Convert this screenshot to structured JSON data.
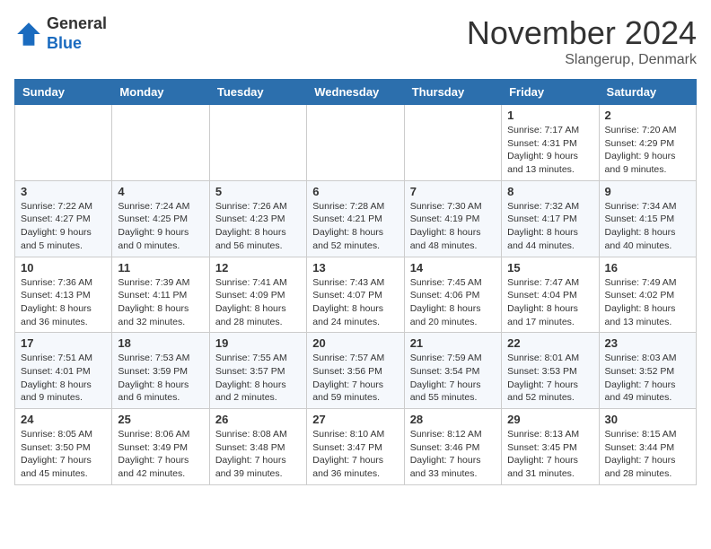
{
  "header": {
    "logo_general": "General",
    "logo_blue": "Blue",
    "month_title": "November 2024",
    "location": "Slangerup, Denmark"
  },
  "weekdays": [
    "Sunday",
    "Monday",
    "Tuesday",
    "Wednesday",
    "Thursday",
    "Friday",
    "Saturday"
  ],
  "weeks": [
    [
      {
        "day": "",
        "sunrise": "",
        "sunset": "",
        "daylight": ""
      },
      {
        "day": "",
        "sunrise": "",
        "sunset": "",
        "daylight": ""
      },
      {
        "day": "",
        "sunrise": "",
        "sunset": "",
        "daylight": ""
      },
      {
        "day": "",
        "sunrise": "",
        "sunset": "",
        "daylight": ""
      },
      {
        "day": "",
        "sunrise": "",
        "sunset": "",
        "daylight": ""
      },
      {
        "day": "1",
        "sunrise": "Sunrise: 7:17 AM",
        "sunset": "Sunset: 4:31 PM",
        "daylight": "Daylight: 9 hours and 13 minutes."
      },
      {
        "day": "2",
        "sunrise": "Sunrise: 7:20 AM",
        "sunset": "Sunset: 4:29 PM",
        "daylight": "Daylight: 9 hours and 9 minutes."
      }
    ],
    [
      {
        "day": "3",
        "sunrise": "Sunrise: 7:22 AM",
        "sunset": "Sunset: 4:27 PM",
        "daylight": "Daylight: 9 hours and 5 minutes."
      },
      {
        "day": "4",
        "sunrise": "Sunrise: 7:24 AM",
        "sunset": "Sunset: 4:25 PM",
        "daylight": "Daylight: 9 hours and 0 minutes."
      },
      {
        "day": "5",
        "sunrise": "Sunrise: 7:26 AM",
        "sunset": "Sunset: 4:23 PM",
        "daylight": "Daylight: 8 hours and 56 minutes."
      },
      {
        "day": "6",
        "sunrise": "Sunrise: 7:28 AM",
        "sunset": "Sunset: 4:21 PM",
        "daylight": "Daylight: 8 hours and 52 minutes."
      },
      {
        "day": "7",
        "sunrise": "Sunrise: 7:30 AM",
        "sunset": "Sunset: 4:19 PM",
        "daylight": "Daylight: 8 hours and 48 minutes."
      },
      {
        "day": "8",
        "sunrise": "Sunrise: 7:32 AM",
        "sunset": "Sunset: 4:17 PM",
        "daylight": "Daylight: 8 hours and 44 minutes."
      },
      {
        "day": "9",
        "sunrise": "Sunrise: 7:34 AM",
        "sunset": "Sunset: 4:15 PM",
        "daylight": "Daylight: 8 hours and 40 minutes."
      }
    ],
    [
      {
        "day": "10",
        "sunrise": "Sunrise: 7:36 AM",
        "sunset": "Sunset: 4:13 PM",
        "daylight": "Daylight: 8 hours and 36 minutes."
      },
      {
        "day": "11",
        "sunrise": "Sunrise: 7:39 AM",
        "sunset": "Sunset: 4:11 PM",
        "daylight": "Daylight: 8 hours and 32 minutes."
      },
      {
        "day": "12",
        "sunrise": "Sunrise: 7:41 AM",
        "sunset": "Sunset: 4:09 PM",
        "daylight": "Daylight: 8 hours and 28 minutes."
      },
      {
        "day": "13",
        "sunrise": "Sunrise: 7:43 AM",
        "sunset": "Sunset: 4:07 PM",
        "daylight": "Daylight: 8 hours and 24 minutes."
      },
      {
        "day": "14",
        "sunrise": "Sunrise: 7:45 AM",
        "sunset": "Sunset: 4:06 PM",
        "daylight": "Daylight: 8 hours and 20 minutes."
      },
      {
        "day": "15",
        "sunrise": "Sunrise: 7:47 AM",
        "sunset": "Sunset: 4:04 PM",
        "daylight": "Daylight: 8 hours and 17 minutes."
      },
      {
        "day": "16",
        "sunrise": "Sunrise: 7:49 AM",
        "sunset": "Sunset: 4:02 PM",
        "daylight": "Daylight: 8 hours and 13 minutes."
      }
    ],
    [
      {
        "day": "17",
        "sunrise": "Sunrise: 7:51 AM",
        "sunset": "Sunset: 4:01 PM",
        "daylight": "Daylight: 8 hours and 9 minutes."
      },
      {
        "day": "18",
        "sunrise": "Sunrise: 7:53 AM",
        "sunset": "Sunset: 3:59 PM",
        "daylight": "Daylight: 8 hours and 6 minutes."
      },
      {
        "day": "19",
        "sunrise": "Sunrise: 7:55 AM",
        "sunset": "Sunset: 3:57 PM",
        "daylight": "Daylight: 8 hours and 2 minutes."
      },
      {
        "day": "20",
        "sunrise": "Sunrise: 7:57 AM",
        "sunset": "Sunset: 3:56 PM",
        "daylight": "Daylight: 7 hours and 59 minutes."
      },
      {
        "day": "21",
        "sunrise": "Sunrise: 7:59 AM",
        "sunset": "Sunset: 3:54 PM",
        "daylight": "Daylight: 7 hours and 55 minutes."
      },
      {
        "day": "22",
        "sunrise": "Sunrise: 8:01 AM",
        "sunset": "Sunset: 3:53 PM",
        "daylight": "Daylight: 7 hours and 52 minutes."
      },
      {
        "day": "23",
        "sunrise": "Sunrise: 8:03 AM",
        "sunset": "Sunset: 3:52 PM",
        "daylight": "Daylight: 7 hours and 49 minutes."
      }
    ],
    [
      {
        "day": "24",
        "sunrise": "Sunrise: 8:05 AM",
        "sunset": "Sunset: 3:50 PM",
        "daylight": "Daylight: 7 hours and 45 minutes."
      },
      {
        "day": "25",
        "sunrise": "Sunrise: 8:06 AM",
        "sunset": "Sunset: 3:49 PM",
        "daylight": "Daylight: 7 hours and 42 minutes."
      },
      {
        "day": "26",
        "sunrise": "Sunrise: 8:08 AM",
        "sunset": "Sunset: 3:48 PM",
        "daylight": "Daylight: 7 hours and 39 minutes."
      },
      {
        "day": "27",
        "sunrise": "Sunrise: 8:10 AM",
        "sunset": "Sunset: 3:47 PM",
        "daylight": "Daylight: 7 hours and 36 minutes."
      },
      {
        "day": "28",
        "sunrise": "Sunrise: 8:12 AM",
        "sunset": "Sunset: 3:46 PM",
        "daylight": "Daylight: 7 hours and 33 minutes."
      },
      {
        "day": "29",
        "sunrise": "Sunrise: 8:13 AM",
        "sunset": "Sunset: 3:45 PM",
        "daylight": "Daylight: 7 hours and 31 minutes."
      },
      {
        "day": "30",
        "sunrise": "Sunrise: 8:15 AM",
        "sunset": "Sunset: 3:44 PM",
        "daylight": "Daylight: 7 hours and 28 minutes."
      }
    ]
  ]
}
